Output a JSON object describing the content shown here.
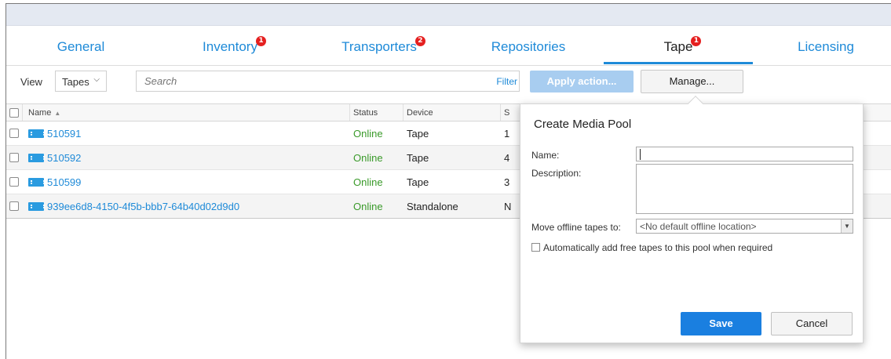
{
  "tabs": [
    {
      "label": "General",
      "badge": ""
    },
    {
      "label": "Inventory",
      "badge": "1"
    },
    {
      "label": "Transporters",
      "badge": "2"
    },
    {
      "label": "Repositories",
      "badge": ""
    },
    {
      "label": "Tape",
      "badge": "1"
    },
    {
      "label": "Licensing",
      "badge": ""
    }
  ],
  "active_tab": "Tape",
  "toolbar": {
    "view_label": "View",
    "view_value": "Tapes",
    "search_placeholder": "Search",
    "filter_label": "Filter",
    "apply_label": "Apply action...",
    "manage_label": "Manage..."
  },
  "grid": {
    "columns": {
      "name": "Name",
      "status": "Status",
      "device": "Device",
      "extra": "S"
    },
    "rows": [
      {
        "name": "510591",
        "status": "Online",
        "device": "Tape",
        "extra": "1"
      },
      {
        "name": "510592",
        "status": "Online",
        "device": "Tape",
        "extra": "4"
      },
      {
        "name": "510599",
        "status": "Online",
        "device": "Tape",
        "extra": "3"
      },
      {
        "name": "939ee6d8-4150-4f5b-bbb7-64b40d02d9d0",
        "status": "Online",
        "device": "Standalone",
        "extra": "N"
      }
    ]
  },
  "dialog": {
    "title": "Create Media Pool",
    "name_label": "Name:",
    "description_label": "Description:",
    "move_label": "Move offline tapes to:",
    "move_value": "<No default offline location>",
    "auto_add_label": "Automatically add free tapes to this pool when required",
    "save_label": "Save",
    "cancel_label": "Cancel"
  },
  "colors": {
    "accent": "#1e8ad8",
    "badge": "#e52020",
    "online": "#3a9a2a",
    "save": "#1a7fe0",
    "apply_disabled": "#a8cdf0"
  },
  "icons": {
    "row_icon": "tape-icon",
    "dropdown": "chevron-down-icon"
  }
}
